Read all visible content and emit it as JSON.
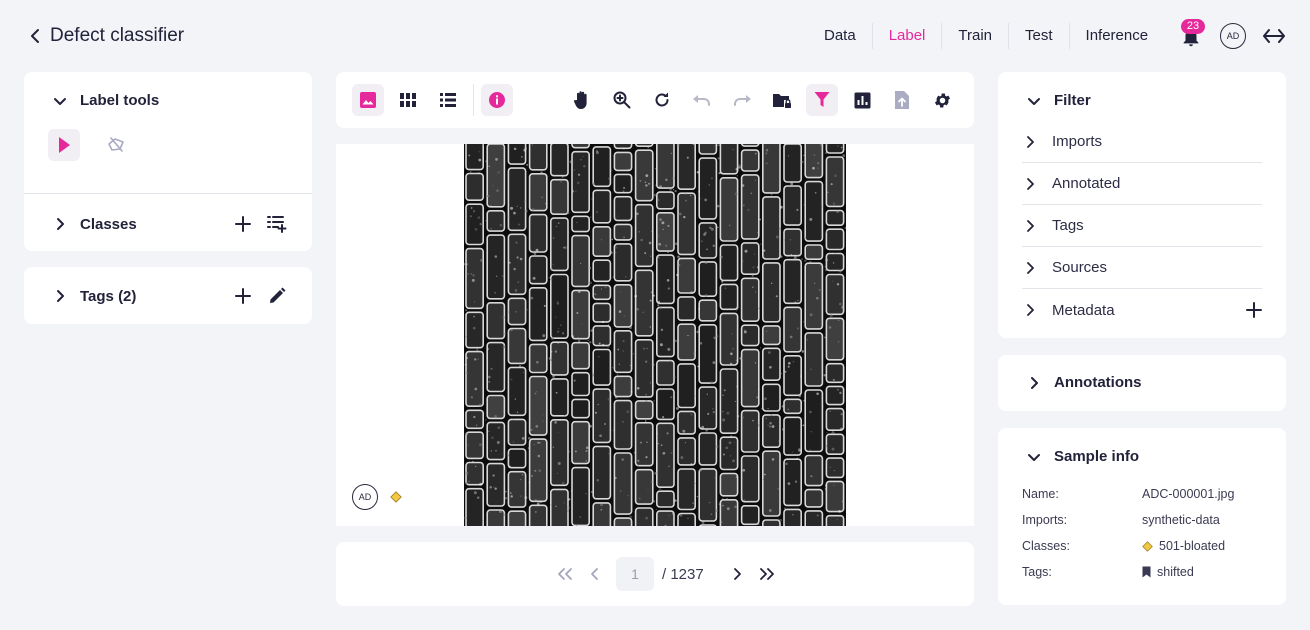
{
  "header": {
    "title": "Defect classifier",
    "nav": [
      {
        "label": "Data"
      },
      {
        "label": "Label",
        "active": true
      },
      {
        "label": "Train"
      },
      {
        "label": "Test"
      },
      {
        "label": "Inference"
      }
    ],
    "notifications_count": "23",
    "avatar_initials": "AD",
    "accent_color": "#e6299a"
  },
  "left": {
    "label_tools": "Label tools",
    "classes": "Classes",
    "tags": "Tags (2)"
  },
  "toolbar": {
    "buttons": [
      "image-view-icon",
      "grid-view-icon",
      "list-view-icon",
      "info-icon",
      "pan-hand-icon",
      "zoom-in-icon",
      "refresh-icon",
      "undo-icon",
      "redo-icon",
      "folder-lock-icon",
      "filter-icon",
      "chart-icon",
      "upload-icon",
      "settings-icon"
    ]
  },
  "canvas": {
    "annotator_initials": "AD",
    "class_color": "#f2c744"
  },
  "pager": {
    "current": "1",
    "total": "/ 1237"
  },
  "filter": {
    "title": "Filter",
    "items": [
      "Imports",
      "Annotated",
      "Tags",
      "Sources",
      "Metadata"
    ]
  },
  "annotations": {
    "title": "Annotations"
  },
  "sample_info": {
    "title": "Sample info",
    "name_label": "Name:",
    "name_value": "ADC-000001.jpg",
    "imports_label": "Imports:",
    "imports_value": "synthetic-data",
    "classes_label": "Classes:",
    "classes_value": "501-bloated",
    "tags_label": "Tags:",
    "tags_value": "shifted"
  }
}
